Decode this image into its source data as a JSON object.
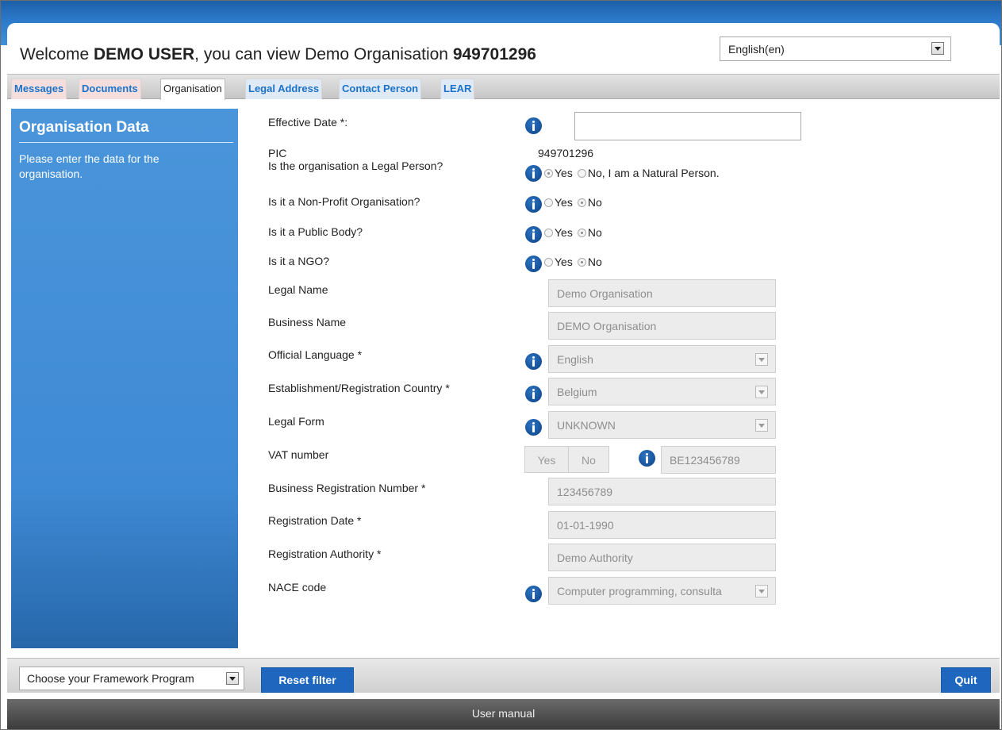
{
  "header": {
    "welcome_prefix": "Welcome ",
    "user_name": "DEMO USER",
    "welcome_middle": ", you can view Demo Organisation ",
    "org_number": "949701296",
    "language": "English(en)"
  },
  "tabs": [
    {
      "label": "Messages"
    },
    {
      "label": "Documents"
    },
    {
      "label": "Organisation"
    },
    {
      "label": "Legal Address"
    },
    {
      "label": "Contact Person"
    },
    {
      "label": "LEAR"
    }
  ],
  "sidebar": {
    "title": "Organisation Data",
    "description": "Please enter the data for the organisation."
  },
  "form": {
    "effective_date_label": "Effective Date *:",
    "pic_label": "PIC",
    "pic_value": "949701296",
    "legal_person_label": "Is the organisation a Legal Person?",
    "legal_person_yes": "Yes",
    "legal_person_no": "No, I am a Natural Person.",
    "non_profit_label": "Is it a Non-Profit Organisation?",
    "public_body_label": "Is it a Public Body?",
    "ngo_label": "Is it a NGO?",
    "yes": "Yes",
    "no": "No",
    "legal_name_label": "Legal Name",
    "legal_name_value": "Demo Organisation",
    "business_name_label": "Business Name",
    "business_name_value": "DEMO Organisation",
    "official_language_label": "Official Language *",
    "official_language_value": "English",
    "country_label": "Establishment/Registration Country *",
    "country_value": "Belgium",
    "legal_form_label": "Legal Form",
    "legal_form_value": "UNKNOWN",
    "vat_label": "VAT number",
    "vat_yes": "Yes",
    "vat_no": "No",
    "vat_value": "BE123456789",
    "brn_label": "Business Registration Number *",
    "brn_value": "123456789",
    "reg_date_label": "Registration Date *",
    "reg_date_value": "01-01-1990",
    "reg_authority_label": "Registration Authority *",
    "reg_authority_value": "Demo Authority",
    "nace_label": "NACE code",
    "nace_value": "Computer programming, consulta"
  },
  "bottom": {
    "framework_select": "Choose your Framework Program",
    "reset_button": "Reset filter",
    "quit_button": "Quit"
  },
  "footer": {
    "user_manual": "User manual"
  },
  "colors": {
    "accent_blue": "#1f67be",
    "sidebar_blue": "#4a95da",
    "tab_link": "#1a73c8"
  }
}
